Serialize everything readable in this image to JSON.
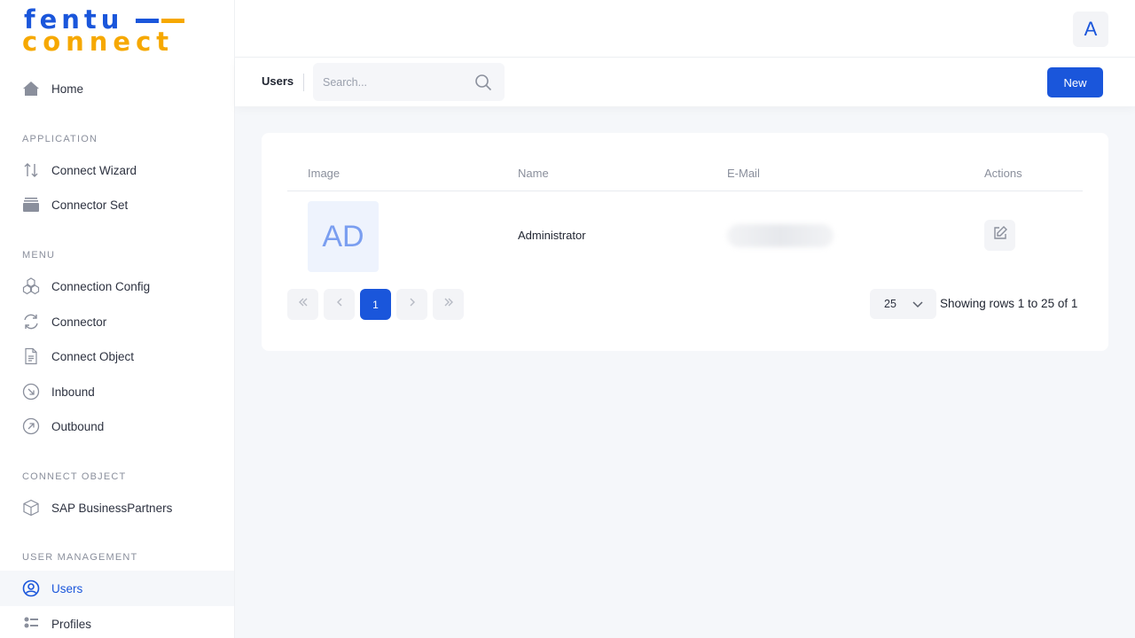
{
  "logo": {
    "line1": "fentu",
    "line2": "connect"
  },
  "sidebar": {
    "home": "Home",
    "sections": {
      "application": "APPLICATION",
      "menu": "MENU",
      "connect_object": "CONNECT OBJECT",
      "user_management": "USER MANAGEMENT"
    },
    "application_items": [
      {
        "label": "Connect Wizard",
        "icon": "arrows-updown-icon"
      },
      {
        "label": "Connector Set",
        "icon": "folder-icon"
      }
    ],
    "menu_items": [
      {
        "label": "Connection Config",
        "icon": "cubes-icon"
      },
      {
        "label": "Connector",
        "icon": "refresh-icon"
      },
      {
        "label": "Connect Object",
        "icon": "document-icon"
      },
      {
        "label": "Inbound",
        "icon": "arrow-down-left-circle-icon"
      },
      {
        "label": "Outbound",
        "icon": "arrow-up-right-circle-icon"
      }
    ],
    "connect_object_items": [
      {
        "label": "SAP BusinessPartners",
        "icon": "box-icon"
      }
    ],
    "user_management_items": [
      {
        "label": "Users",
        "icon": "user-circle-icon",
        "active": true
      },
      {
        "label": "Profiles",
        "icon": "list-icon"
      }
    ]
  },
  "header": {
    "avatar_initial": "A"
  },
  "toolbar": {
    "title": "Users",
    "search_placeholder": "Search...",
    "new_label": "New"
  },
  "table": {
    "columns": [
      "Image",
      "Name",
      "E-Mail",
      "Actions"
    ],
    "rows": [
      {
        "initials": "AD",
        "name": "Administrator",
        "email": ""
      }
    ]
  },
  "pagination": {
    "current_page": "1",
    "page_size": "25",
    "info": "Showing rows 1 to 25 of 1"
  },
  "colors": {
    "accent": "#1a56db",
    "logo_yellow": "#f6a800"
  }
}
